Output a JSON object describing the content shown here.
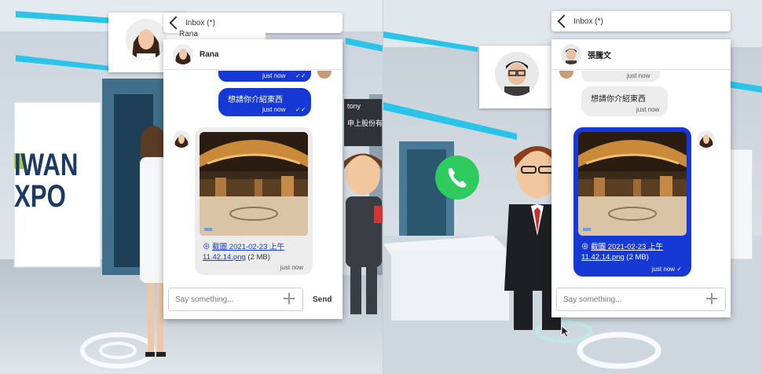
{
  "left": {
    "inbox_label": "Inbox (*)",
    "name_tag": "Rana",
    "chat_title": "Rana",
    "msg_top_time": "just now",
    "msg_top_check": "✓✓",
    "msg_sent_text": "想請你介紹東西",
    "msg_sent_time": "just now",
    "msg_sent_check": "✓✓",
    "file_prefix": "⊕ ",
    "file_name": "截圖 2021-02-23 上午11.42.14.png",
    "file_size": " (2 MB)",
    "file_time": "just now",
    "input_placeholder": "Say something...",
    "send_label": "Send",
    "booth_line1": "IWAN",
    "booth_line2": "XPO",
    "side_name": "tony",
    "side_text": "申上股份有"
  },
  "right": {
    "inbox_label": "Inbox (*)",
    "chat_title": "張騰文",
    "msg_top_time": "just now",
    "msg_received_text": "想請你介紹東西",
    "msg_received_time": "just now",
    "file_prefix": "⊕ ",
    "file_name": "截圖 2021-02-23 上午11.42.14.png",
    "file_size": " (2 MB)",
    "file_time": "just now ✓",
    "input_placeholder": "Say something..."
  },
  "colors": {
    "blue_bubble": "#1638d4",
    "grey_bubble": "#ececec",
    "call_green": "#2ecc5f"
  },
  "icons": [
    "back-chevron-icon",
    "plus-icon",
    "phone-icon",
    "cursor-icon"
  ]
}
